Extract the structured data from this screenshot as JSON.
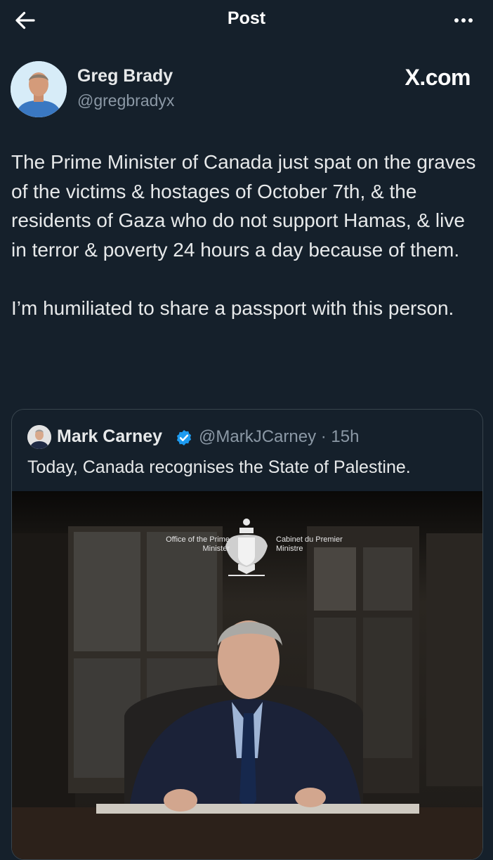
{
  "header": {
    "title": "Post"
  },
  "author": {
    "name": "Greg Brady",
    "handle": "@gregbradyx"
  },
  "watermark": "X.com",
  "tweet": {
    "paragraphs": [
      "The Prime Minister of Canada just spat on the graves of the victims & hostages of October 7th, & the residents of Gaza who do not support Hamas, & live in terror & poverty 24 hours a day because of them.",
      "I’m humiliated to share a passport with this person."
    ]
  },
  "quoted": {
    "name": "Mark Carney",
    "handle_time": "@MarkJCarney · 15h",
    "text": "Today, Canada recognises the State of Palestine.",
    "media": {
      "office_en": "Office of the Prime Minister",
      "office_fr": "Cabinet du Premier Ministre"
    }
  },
  "colors": {
    "background": "#15202b",
    "text": "#e7e9ea",
    "muted": "#8b98a5",
    "border": "#38444d",
    "verified": "#1d9bf0"
  },
  "icons": [
    "arrow-left-icon",
    "more-horizontal-icon",
    "verified-badge-icon"
  ]
}
